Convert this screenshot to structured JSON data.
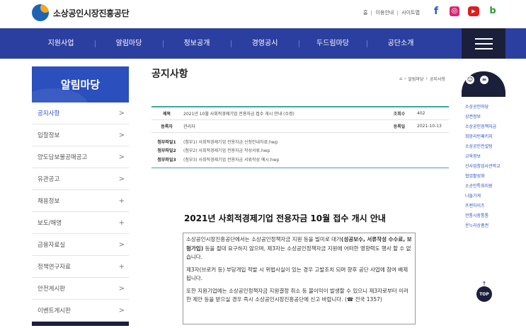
{
  "header": {
    "org_name": "소상공인시장진흥공단",
    "utils": [
      "홈",
      "이용안내",
      "사이트맵"
    ],
    "sns": [
      {
        "name": "facebook-icon",
        "glyph": "f"
      },
      {
        "name": "instagram-icon",
        "glyph": "◎"
      },
      {
        "name": "youtube-icon",
        "glyph": "▶"
      },
      {
        "name": "blog-icon",
        "glyph": "b"
      }
    ]
  },
  "nav": {
    "items": [
      "지원사업",
      "알림마당",
      "정보공개",
      "경영공시",
      "두드림마당",
      "공단소개"
    ]
  },
  "sidebar": {
    "title": "알림마당",
    "items": [
      {
        "label": "공지사항",
        "icon": ">",
        "active": true
      },
      {
        "label": "입찰정보",
        "icon": ">"
      },
      {
        "label": "양도담보물공매공고",
        "icon": ">"
      },
      {
        "label": "유관공고",
        "icon": ">"
      },
      {
        "label": "채용정보",
        "icon": "+"
      },
      {
        "label": "보도/해명",
        "icon": "+"
      },
      {
        "label": "금융자료실",
        "icon": ">"
      },
      {
        "label": "정책연구자료",
        "icon": "+"
      },
      {
        "label": "안전게시판",
        "icon": ">"
      },
      {
        "label": "이벤트게시판",
        "icon": ">"
      }
    ]
  },
  "main": {
    "page_title": "공지사항",
    "breadcrumb": [
      "알림마당",
      "공지사항"
    ],
    "board": {
      "title_label": "제목",
      "title_value": "2021년 10월 사회적경제기업 전용자금 접수 개시 안내 (수정)",
      "views_label": "조회수",
      "views_value": "402",
      "author_label": "등록자",
      "author_value": "관리자",
      "date_label": "등록일",
      "date_value": "2021-10-13",
      "files": [
        {
          "label": "첨부파일1",
          "name": "(첨부1) 사회적경제기업 전용자금 신청안내자료.hwp"
        },
        {
          "label": "첨부파일2",
          "name": "(첨부2) 사회적경제기업 전용자금 작성서류.hwp"
        },
        {
          "label": "첨부파일3",
          "name": "(첨부3) 사회적경제기업 전용자금 서류작성 예시.hwp"
        }
      ]
    },
    "doc_title": "2021년 사회적경제기업 전용자금 10월 접수 개시 안내",
    "notice": {
      "p1_a": "소상공인시장진흥공단에서는 소상공인정책자금 지원 등을 빌미로 대가",
      "p1_bold": "(성공보수, 서류작성 수수료, 보험가입)",
      "p1_b": " 등을 절대 요구하지 않으며, 제3자는 소상공인정책자금 지원에 어떠한 영향력도 행사 할 수 없습니다.",
      "p2": "제3자(브로커 등) 부당개입 적발 시 위법사실이 있는 경우 고발조치 되며 향후 공단 사업에 참여 배제됩니다.",
      "p3": "또한 지원기업에는 소상공인정책자금 지원결정 취소 등 불이익이 발생할 수 있으니 제3자로부터 이러한 제안 등을 받으실 경우 즉시 소상공인시장진흥공단에 신고 바랍니다. (☎ 전국 1357)"
    }
  },
  "quick_menu": {
    "items": [
      "소상공인마당",
      "상권정보",
      "소상공인정책자금",
      "희망리턴패키지",
      "소상공인컨설팅",
      "교육정보",
      "신사업창업사관학교",
      "협업활성화",
      "소공인특화지원",
      "나들가게",
      "프랜차이즈",
      "전통시장통통",
      "온누리상품권"
    ],
    "top_label": "TOP"
  }
}
